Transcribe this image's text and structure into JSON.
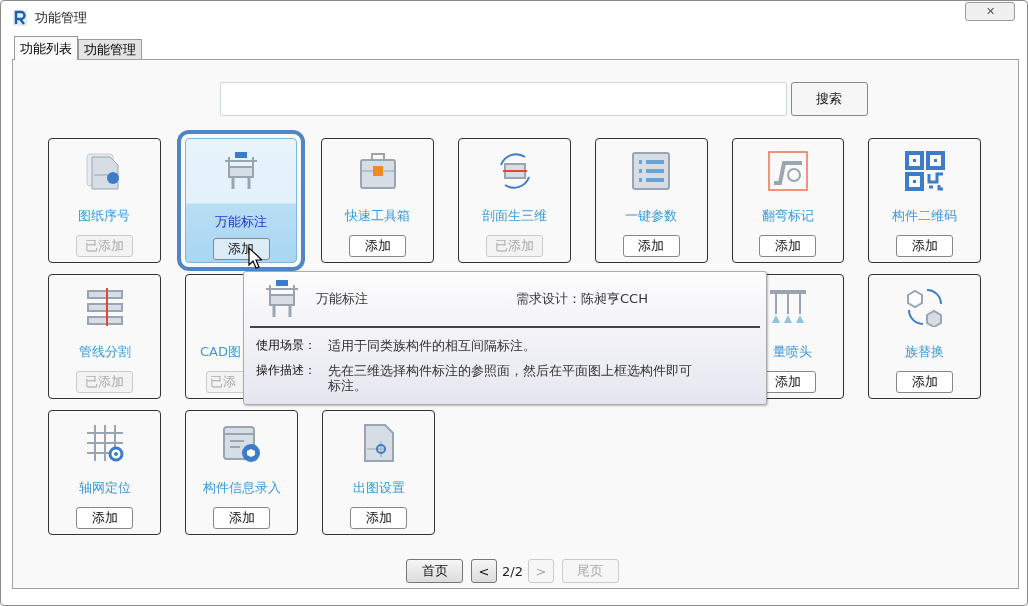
{
  "window": {
    "title": "功能管理",
    "close": "✕"
  },
  "tabs": [
    {
      "label": "功能列表",
      "selected": true
    },
    {
      "label": "功能管理",
      "selected": false
    }
  ],
  "search": {
    "button": "搜索"
  },
  "card_rows": [
    [
      {
        "kind": "full",
        "label": "图纸序号",
        "button": "已添加",
        "added": true,
        "selected": false
      },
      {
        "kind": "full",
        "label": "万能标注",
        "button": "添加",
        "added": false,
        "selected": true
      },
      {
        "kind": "full",
        "label": "快速工具箱",
        "button": "添加",
        "added": false,
        "selected": false
      },
      {
        "kind": "full",
        "label": "剖面生三维",
        "button": "已添加",
        "added": true,
        "selected": false
      },
      {
        "kind": "full",
        "label": "一键参数",
        "button": "添加",
        "added": false,
        "selected": false
      },
      {
        "kind": "full",
        "label": "翻弯标记",
        "button": "添加",
        "added": false,
        "selected": false
      },
      {
        "kind": "full",
        "label": "构件二维码",
        "button": "添加",
        "added": false,
        "selected": false
      }
    ],
    [
      {
        "kind": "full",
        "label": "管线分割",
        "button": "已添加",
        "added": true,
        "selected": false
      },
      {
        "kind": "partial_left",
        "label": "CAD图",
        "button": "已添",
        "added": true,
        "selected": false
      },
      {
        "kind": "partial_right",
        "label": "量喷头",
        "button": "添加",
        "added": false,
        "selected": false
      },
      {
        "kind": "full",
        "label": "族替换",
        "button": "添加",
        "added": false,
        "selected": false
      }
    ],
    [
      {
        "kind": "full",
        "label": "轴网定位",
        "button": "添加",
        "added": false,
        "selected": false
      },
      {
        "kind": "full",
        "label": "构件信息录入",
        "button": "添加",
        "added": false,
        "selected": false
      },
      {
        "kind": "full",
        "label": "出图设置",
        "button": "添加",
        "added": false,
        "selected": false
      }
    ]
  ],
  "tooltip": {
    "title": "万能标注",
    "designer": "需求设计：陈昶亨CCH",
    "rows": [
      {
        "label": "使用场景：",
        "text": "适用于同类族构件的相互间隔标注。"
      },
      {
        "label": "操作描述：",
        "text": "先在三维选择构件标注的参照面，然后在平面图上框选构件即可标注。"
      }
    ]
  },
  "pager": {
    "first": {
      "label": "首页",
      "disabled": false
    },
    "prev": {
      "label": "<",
      "disabled": false
    },
    "page": "2/2",
    "next": {
      "label": ">",
      "disabled": true
    },
    "last": {
      "label": "尾页",
      "disabled": true
    }
  }
}
